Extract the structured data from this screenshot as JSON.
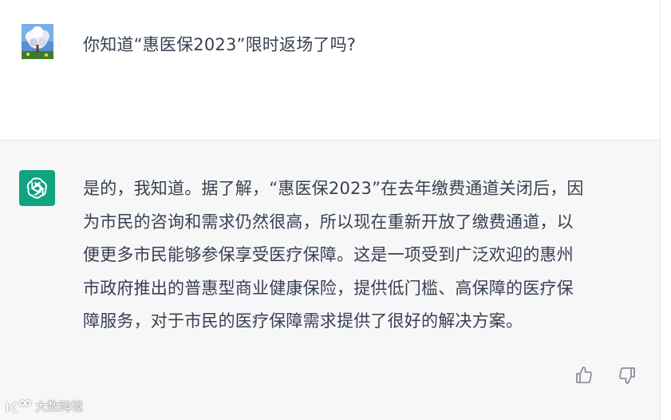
{
  "user_message": {
    "avatar_icon": "user-avatar-tree-photo",
    "text": "你知道“惠医保2023”限时返场了吗?"
  },
  "assistant_message": {
    "avatar_icon": "openai-logo-icon",
    "lines": [
      "是的，我知道。据了解，“惠医保2023”在去年缴费通道关闭后，因",
      "为市民的咨询和需求仍然很高，所以现在重新开放了缴费通道，以",
      "便更多市民能够参保享受医疗保障。这是一项受到广泛欢迎的惠州",
      "市政府推出的普惠型商业健康保险，提供低门槛、高保障的医疗保",
      "障服务，对于市民的医疗保障需求提供了很好的解决方案。"
    ]
  },
  "feedback": {
    "thumbs_up_icon": "thumbs-up-icon",
    "thumbs_down_icon": "thumbs-down-icon"
  },
  "watermark": {
    "text": "大数跨境"
  },
  "colors": {
    "assistant_bg": "#f7f7f8",
    "user_bg": "#ffffff",
    "brand_green": "#10a37f",
    "text": "#374151",
    "icon_gray": "#8e8ea0"
  }
}
